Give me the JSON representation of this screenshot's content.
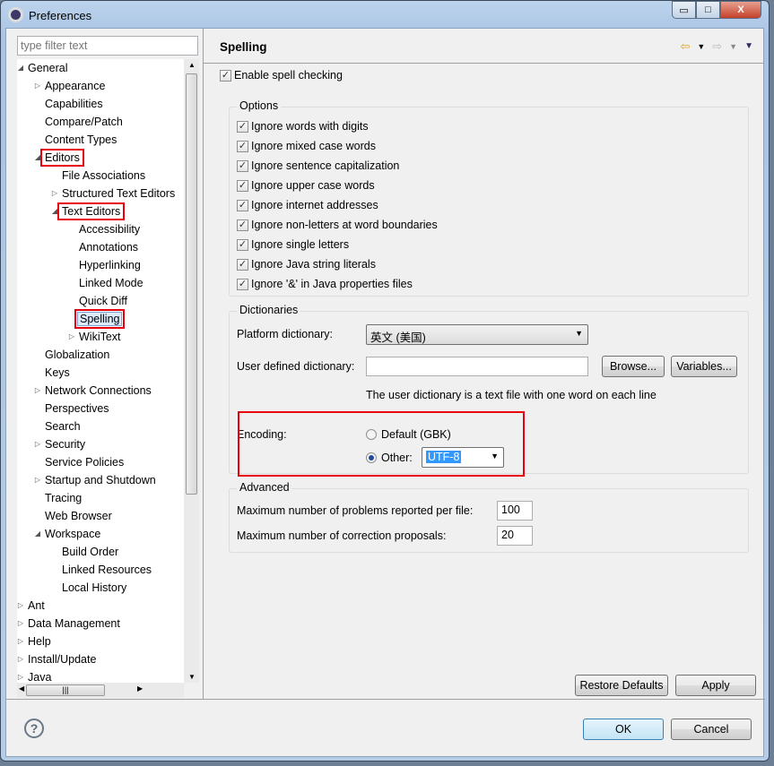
{
  "window": {
    "title": "Preferences",
    "minimize": "▭",
    "maximize": "□",
    "close": "X"
  },
  "filter": {
    "placeholder": "type filter text"
  },
  "tree": [
    {
      "label": "General",
      "level": 0,
      "state": "expanded"
    },
    {
      "label": "Appearance",
      "level": 1,
      "state": "collapsed"
    },
    {
      "label": "Capabilities",
      "level": 1
    },
    {
      "label": "Compare/Patch",
      "level": 1
    },
    {
      "label": "Content Types",
      "level": 1
    },
    {
      "label": "Editors",
      "level": 1,
      "state": "expanded",
      "highlighted": true
    },
    {
      "label": "File Associations",
      "level": 2
    },
    {
      "label": "Structured Text Editors",
      "level": 2,
      "state": "collapsed"
    },
    {
      "label": "Text Editors",
      "level": 2,
      "state": "expanded",
      "highlighted": true
    },
    {
      "label": "Accessibility",
      "level": 3
    },
    {
      "label": "Annotations",
      "level": 3
    },
    {
      "label": "Hyperlinking",
      "level": 3
    },
    {
      "label": "Linked Mode",
      "level": 3
    },
    {
      "label": "Quick Diff",
      "level": 3
    },
    {
      "label": "Spelling",
      "level": 3,
      "highlighted": true,
      "selected": true
    },
    {
      "label": "WikiText",
      "level": 3,
      "state": "collapsed"
    },
    {
      "label": "Globalization",
      "level": 1
    },
    {
      "label": "Keys",
      "level": 1
    },
    {
      "label": "Network Connections",
      "level": 1,
      "state": "collapsed"
    },
    {
      "label": "Perspectives",
      "level": 1
    },
    {
      "label": "Search",
      "level": 1
    },
    {
      "label": "Security",
      "level": 1,
      "state": "collapsed"
    },
    {
      "label": "Service Policies",
      "level": 1
    },
    {
      "label": "Startup and Shutdown",
      "level": 1,
      "state": "collapsed"
    },
    {
      "label": "Tracing",
      "level": 1
    },
    {
      "label": "Web Browser",
      "level": 1
    },
    {
      "label": "Workspace",
      "level": 1,
      "state": "expanded"
    },
    {
      "label": "Build Order",
      "level": 2
    },
    {
      "label": "Linked Resources",
      "level": 2
    },
    {
      "label": "Local History",
      "level": 2
    },
    {
      "label": "Ant",
      "level": 0,
      "state": "collapsed"
    },
    {
      "label": "Data Management",
      "level": 0,
      "state": "collapsed"
    },
    {
      "label": "Help",
      "level": 0,
      "state": "collapsed"
    },
    {
      "label": "Install/Update",
      "level": 0,
      "state": "collapsed"
    },
    {
      "label": "Java",
      "level": 0,
      "state": "collapsed"
    }
  ],
  "page": {
    "title": "Spelling",
    "enable": {
      "label": "Enable spell checking",
      "checked": true
    },
    "options": {
      "title": "Options",
      "items": [
        "Ignore words with digits",
        "Ignore mixed case words",
        "Ignore sentence capitalization",
        "Ignore upper case words",
        "Ignore internet addresses",
        "Ignore non-letters at word boundaries",
        "Ignore single letters",
        "Ignore Java string literals",
        "Ignore '&' in Java properties files"
      ]
    },
    "dictionaries": {
      "title": "Dictionaries",
      "platform_label": "Platform dictionary:",
      "platform_value": "英文 (美国)",
      "user_label": "User defined dictionary:",
      "user_value": "",
      "browse": "Browse...",
      "variables": "Variables...",
      "note": "The user dictionary is a text file with one word on each line"
    },
    "encoding": {
      "label": "Encoding:",
      "default": "Default (GBK)",
      "other": "Other:",
      "other_value": "UTF-8",
      "selected": "other"
    },
    "advanced": {
      "title": "Advanced",
      "max_problems_label": "Maximum number of problems reported per file:",
      "max_problems": "100",
      "max_proposals_label": "Maximum number of correction proposals:",
      "max_proposals": "20"
    }
  },
  "buttons": {
    "restore": "Restore Defaults",
    "apply": "Apply",
    "ok": "OK",
    "cancel": "Cancel",
    "help": "?"
  },
  "colors": {
    "highlight": "#e8000f",
    "selection": "#3399ff"
  }
}
